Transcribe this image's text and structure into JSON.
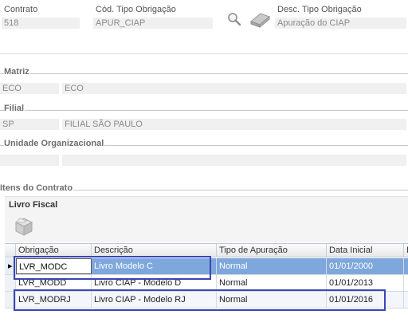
{
  "header": {
    "contrato_label": "Contrato",
    "contrato_value": "518",
    "cod_tipo_label": "Cód. Tipo Obrigação",
    "cod_tipo_value": "APUR_CIAP",
    "desc_tipo_label": "Desc. Tipo Obrigação",
    "desc_tipo_value": "Apuração do CIAP"
  },
  "matriz": {
    "title": "Matriz",
    "code": "ECO",
    "name": "ECO"
  },
  "filial": {
    "title": "Filial",
    "code": "SP",
    "name": "FILIAL SÃO PAULO"
  },
  "unidade": {
    "title": "Unidade Organizacional",
    "code": "",
    "name": ""
  },
  "itens": {
    "title": "Itens do Contrato"
  },
  "livro": {
    "title": "Livro Fiscal"
  },
  "icons": {
    "search": "magnifier-icon",
    "eraser": "eraser-icon",
    "toolbar_box": "box-icon"
  },
  "grid": {
    "columns": [
      "Obrigação",
      "Descrição",
      "Tipo de Apuração",
      "Data Inicial",
      "D"
    ],
    "rows": [
      {
        "obrigacao": "LVR_MODC",
        "descricao": "Livro Modelo C",
        "tipo": "Normal",
        "data": "01/01/2000",
        "selected": true
      },
      {
        "obrigacao": "LVR_MODD",
        "descricao": "Livro CIAP - Modelo D",
        "tipo": "Normal",
        "data": "01/01/2013",
        "selected": false
      },
      {
        "obrigacao": "LVR_MODRJ",
        "descricao": "Livro CIAP - Modelo RJ",
        "tipo": "Normal",
        "data": "01/01/2016",
        "selected": false
      }
    ]
  },
  "colors": {
    "selection": "#7ea7dc",
    "highlight_box": "#3a46b8"
  }
}
